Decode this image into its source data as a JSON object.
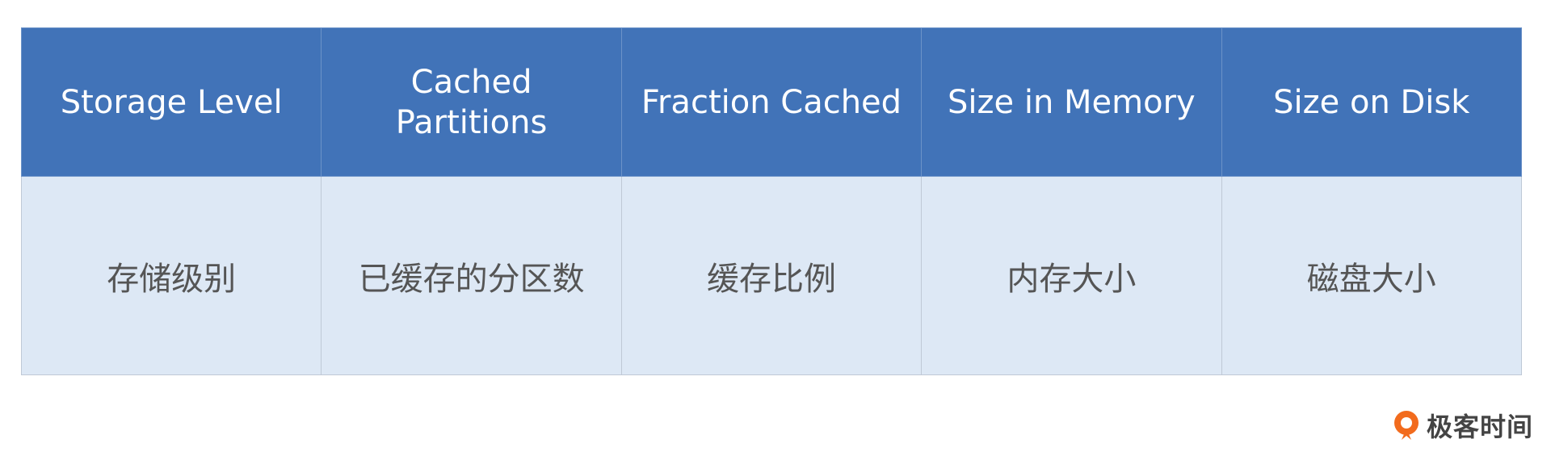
{
  "table": {
    "headers": [
      "Storage Level",
      "Cached Partitions",
      "Fraction Cached",
      "Size in Memory",
      "Size on Disk"
    ],
    "rows": [
      [
        "存储级别",
        "已缓存的分区数",
        "缓存比例",
        "内存大小",
        "磁盘大小"
      ]
    ]
  },
  "branding": {
    "logo_text": "极客时间"
  },
  "colors": {
    "header_bg": "#4173b8",
    "header_text": "#ffffff",
    "body_bg": "#dde8f5",
    "body_text": "#555555",
    "logo_orange": "#f26b1d"
  }
}
